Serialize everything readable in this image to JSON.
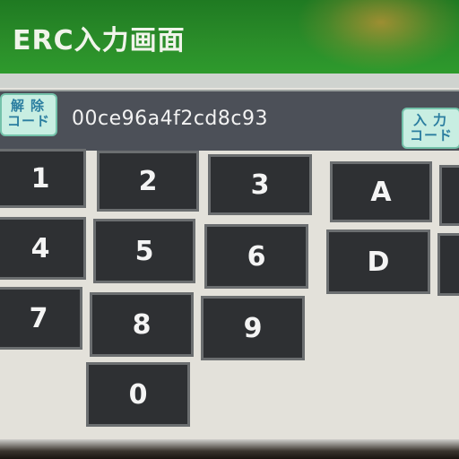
{
  "header": {
    "title": "ERC入力画面"
  },
  "code_bar": {
    "release_button": {
      "line1": "解除",
      "line2": "コード"
    },
    "code_value": "00ce96a4f2cd8c93",
    "input_button": {
      "line1": "入力",
      "line2": "コード"
    }
  },
  "keypad": {
    "keys": [
      "1",
      "2",
      "3",
      "A",
      "4",
      "5",
      "6",
      "D",
      "7",
      "8",
      "9",
      "0"
    ]
  },
  "colors": {
    "title_bar": "#2a8c29",
    "code_bar": "#4c5058",
    "code_button_bg": "#c8eee2",
    "key_bg": "#2e3033"
  }
}
